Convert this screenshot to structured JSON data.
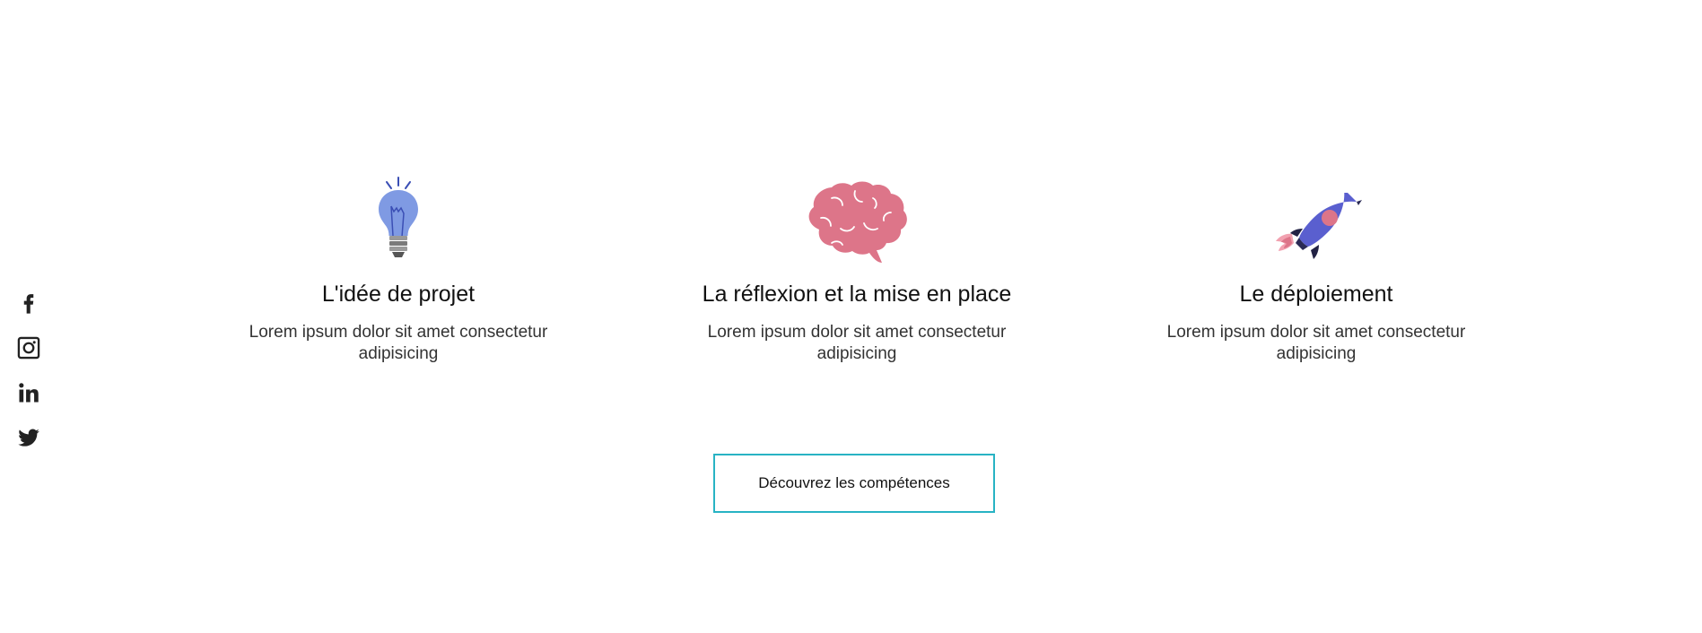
{
  "social": [
    {
      "name": "facebook-icon",
      "label": "Facebook"
    },
    {
      "name": "instagram-icon",
      "label": "Instagram"
    },
    {
      "name": "linkedin-icon",
      "label": "LinkedIn"
    },
    {
      "name": "twitter-icon",
      "label": "Twitter"
    }
  ],
  "features": [
    {
      "icon": "lightbulb-icon",
      "title": "L'idée de projet",
      "text": "Lorem ipsum dolor sit amet consectetur adipisicing"
    },
    {
      "icon": "brain-icon",
      "title": "La réflexion et la mise en place",
      "text": "Lorem ipsum dolor sit amet consectetur adipisicing"
    },
    {
      "icon": "rocket-icon",
      "title": "Le déploiement",
      "text": "Lorem ipsum dolor sit amet consectetur adipisicing"
    }
  ],
  "cta": {
    "label": "Découvrez les compétences"
  },
  "colors": {
    "accent_border": "#28b3c4",
    "bulb": "#7f9ae3",
    "brain": "#dd7589",
    "rocket": "#5a5fcf",
    "icon_dark": "#222222"
  }
}
